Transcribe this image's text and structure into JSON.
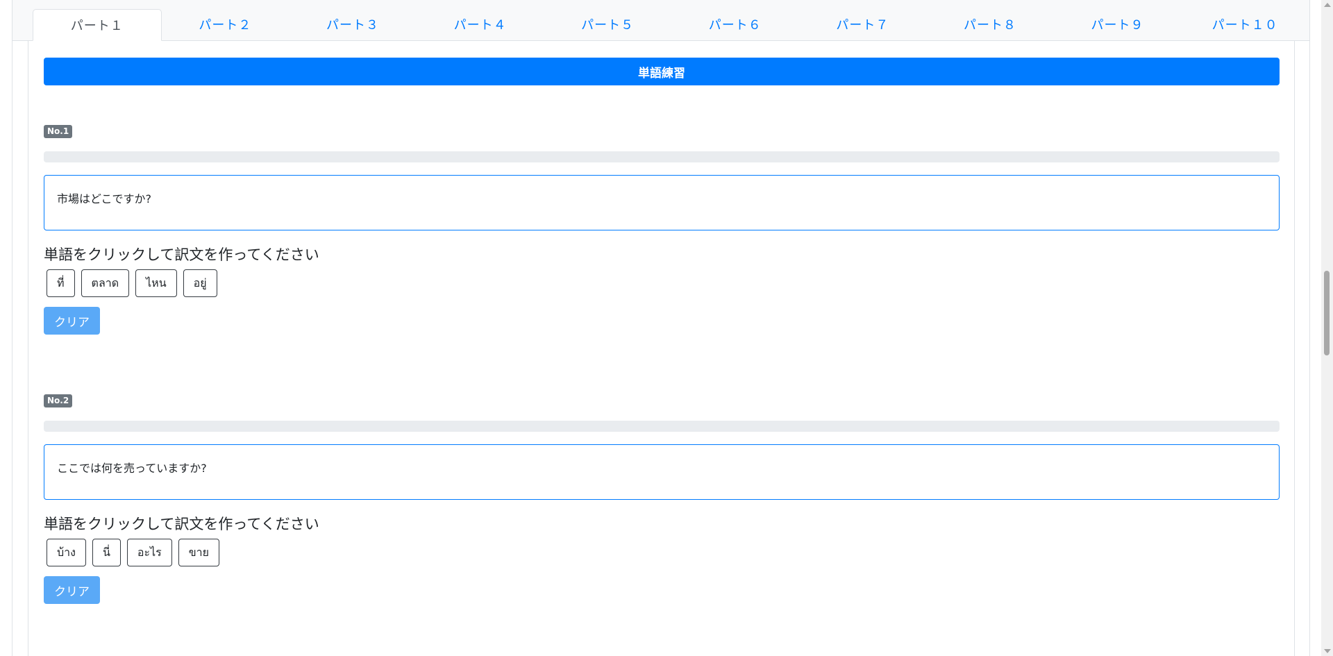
{
  "tabs": [
    "パート１",
    "パート２",
    "パート３",
    "パート４",
    "パート５",
    "パート６",
    "パート７",
    "パート８",
    "パート９",
    "パート１０"
  ],
  "header": {
    "title": "単語練習"
  },
  "questions": [
    {
      "badge": "No.1",
      "answer_text": "市場はどこですか?",
      "instruction": "単語をクリックして訳文を作ってください",
      "words": [
        "ที่",
        "ตลาด",
        "ไหน",
        "อยู่"
      ],
      "clear_label": "クリア"
    },
    {
      "badge": "No.2",
      "answer_text": "ここでは何を売っていますか?",
      "instruction": "単語をクリックして訳文を作ってください",
      "words": [
        "บ้าง",
        "นี่",
        "อะไร",
        "ขาย"
      ],
      "clear_label": "クリア"
    }
  ]
}
